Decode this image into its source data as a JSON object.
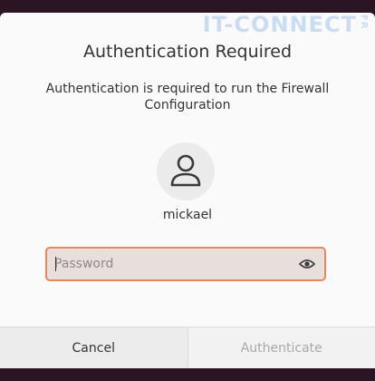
{
  "watermark": {
    "text": "IT-CONNECT",
    "suffix": "FR"
  },
  "dialog": {
    "title": "Authentication Required",
    "message": "Authentication is required to run the Firewall Configuration",
    "user": {
      "avatar_icon": "person-icon",
      "name": "mickael"
    },
    "password": {
      "placeholder": "Password",
      "value": "",
      "reveal_icon": "eye-icon"
    },
    "buttons": {
      "cancel": "Cancel",
      "authenticate": "Authenticate"
    }
  },
  "colors": {
    "accent": "#e9875a",
    "background": "#2b1524"
  }
}
